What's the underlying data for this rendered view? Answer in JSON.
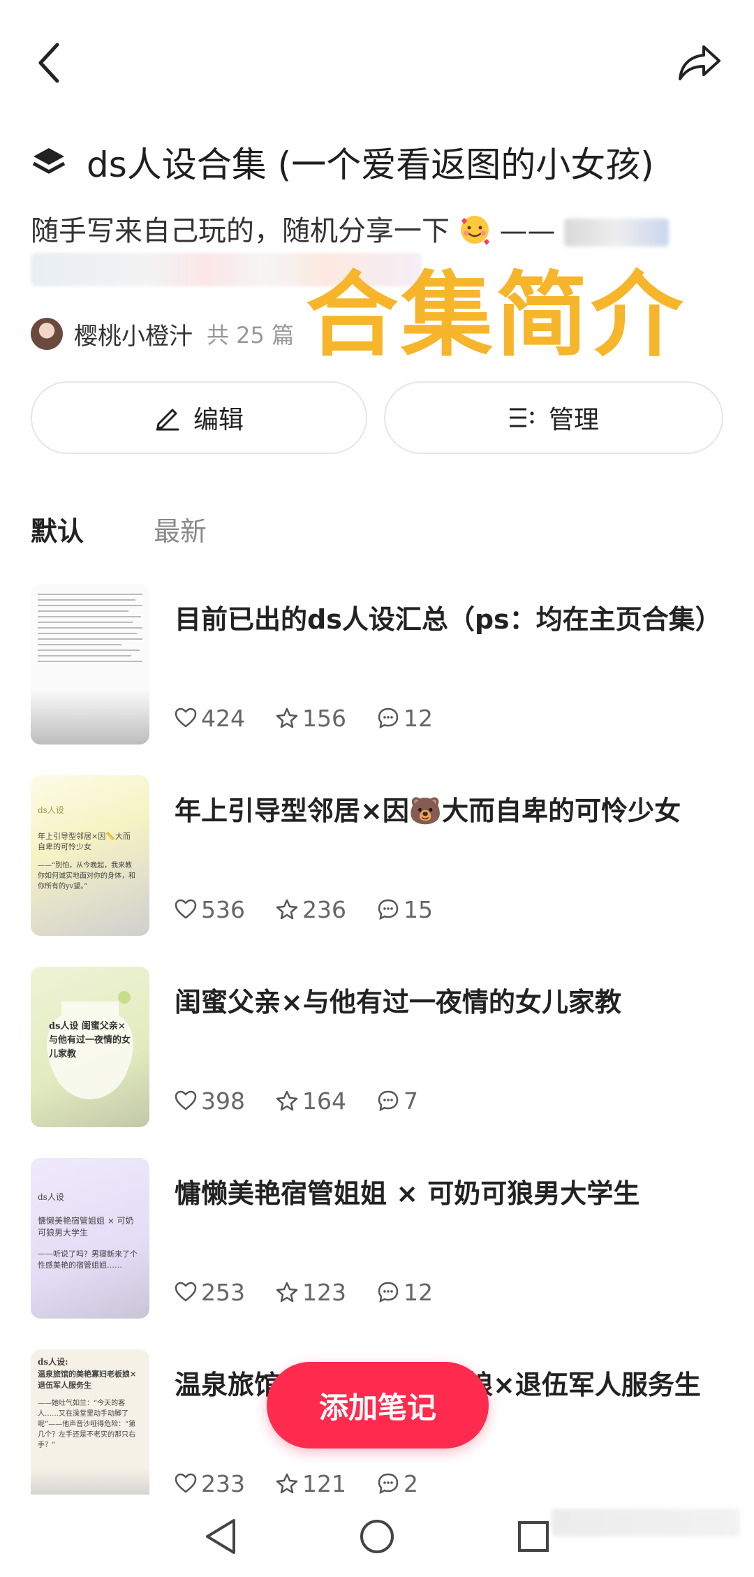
{
  "collection": {
    "title": "ds人设合集 (一个爱看返图的小女孩)",
    "description": "随手写来自己玩的，随机分享一下",
    "description_dash": "——",
    "overlay_label": "合集简介",
    "author": "樱桃小橙汁",
    "post_count": "共 25 篇"
  },
  "actions": {
    "edit_label": "编辑",
    "manage_label": "管理"
  },
  "tabs": [
    {
      "label": "默认",
      "active": true
    },
    {
      "label": "最新",
      "active": false
    }
  ],
  "notes": [
    {
      "title": "目前已出的ds人设汇总（ps：均在主页合集）",
      "likes": "424",
      "stars": "156",
      "comments": "12"
    },
    {
      "title": "年上引导型邻居×因🐻大而自卑的可怜少女",
      "likes": "536",
      "stars": "236",
      "comments": "15",
      "thumb_tag": "ds人设",
      "thumb_text": "年上引导型邻居×因📏大而自卑的可怜少女",
      "thumb_quote": "——“别怕，从今晚起，我来教你如何诚实地面对你的身体，和你所有的yv望。”"
    },
    {
      "title": "闺蜜父亲×与他有过一夜情的女儿家教",
      "likes": "398",
      "stars": "164",
      "comments": "7",
      "thumb_text": "ds人设 闺蜜父亲×与他有过一夜情的女儿家教"
    },
    {
      "title": "慵懒美艳宿管姐姐 × 可奶可狼男大学生",
      "likes": "253",
      "stars": "123",
      "comments": "12",
      "thumb_tag": "ds人设",
      "thumb_text": "慵懒美艳宿管姐姐 × 可奶可狼男大学生",
      "thumb_quote": "——听说了吗？男寝新来了个性感美艳的宿管姐姐……"
    },
    {
      "title": "温泉旅馆的美艳寡妇老板娘×退伍军人服务生",
      "likes": "233",
      "stars": "121",
      "comments": "2",
      "thumb_tag": "ds人设:",
      "thumb_text": "温泉旅馆的美艳寡妇老板娘×退伍军人服务生",
      "thumb_quote": "——她吐气如兰：“今天的客人……又在澡堂里动手动脚了呢”——他声音沙哑得危险：“第几个？左手还是不老实的那只右手？”"
    }
  ],
  "fab": {
    "label": "添加笔记"
  },
  "colors": {
    "accent": "#ff2b4e",
    "overlay": "#f7b52c"
  }
}
